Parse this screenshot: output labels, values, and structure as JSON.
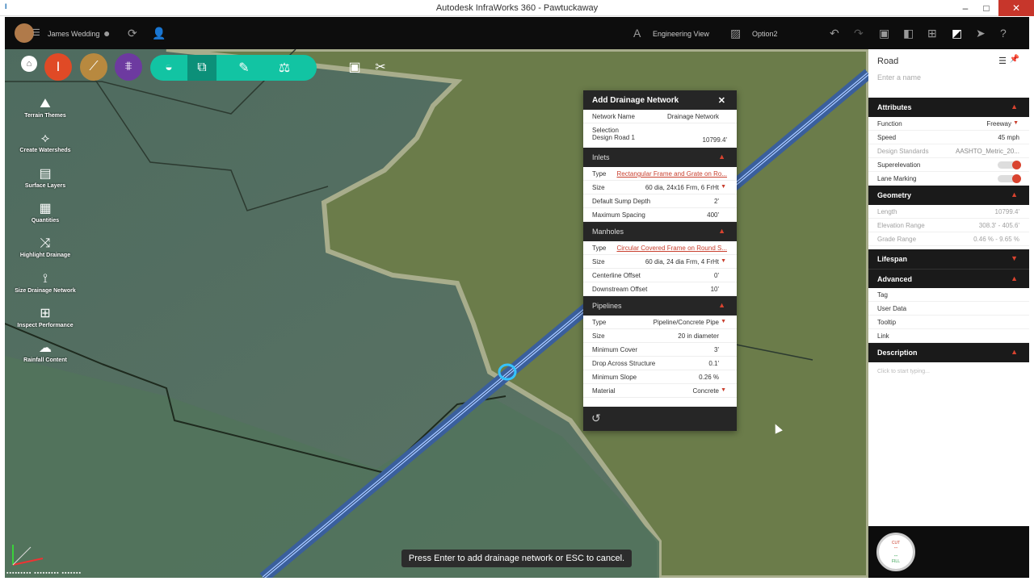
{
  "window": {
    "title": "Autodesk InfraWorks 360 - Pawtuckaway",
    "app_icon": "I"
  },
  "topbar": {
    "user": "James Wedding",
    "engineering_view": "Engineering View",
    "option": "Option2"
  },
  "left_tools": [
    {
      "label": "Terrain Themes",
      "icon": "terrain-themes-icon",
      "glyph": "⛰"
    },
    {
      "label": "Create Watersheds",
      "icon": "create-watersheds-icon",
      "glyph": "⟡"
    },
    {
      "label": "Surface Layers",
      "icon": "surface-layers-icon",
      "glyph": "▤"
    },
    {
      "label": "Quantities",
      "icon": "quantities-icon",
      "glyph": "▦"
    },
    {
      "label": "Highlight Drainage",
      "icon": "highlight-drainage-icon",
      "glyph": "⤨"
    },
    {
      "label": "Size Drainage Network",
      "icon": "size-drainage-network-icon",
      "glyph": "⟟"
    },
    {
      "label": "Inspect Performance",
      "icon": "inspect-performance-icon",
      "glyph": "⊞"
    },
    {
      "label": "Rainfall Content",
      "icon": "rainfall-content-icon",
      "glyph": "☁"
    }
  ],
  "dialog": {
    "title": "Add Drainage Network",
    "network_name_label": "Network Name",
    "network_name_value": "Drainage Network",
    "selection_label": "Selection",
    "selection_item": "Design Road 1",
    "selection_value": "10799.4'",
    "inlets": {
      "title": "Inlets",
      "rows": [
        {
          "label": "Type",
          "value": "Rectangular Frame and Grate on Ro..."
        },
        {
          "label": "Size",
          "value": "60 dia, 24x16 Frm, 6 FrHt"
        },
        {
          "label": "Default Sump Depth",
          "value": "2'"
        },
        {
          "label": "Maximum Spacing",
          "value": "400'"
        }
      ]
    },
    "manholes": {
      "title": "Manholes",
      "rows": [
        {
          "label": "Type",
          "value": "Circular Covered Frame on Round S..."
        },
        {
          "label": "Size",
          "value": "60 dia, 24 dia Frm, 4 FrHt"
        },
        {
          "label": "Centerline Offset",
          "value": "0'"
        },
        {
          "label": "Downstream Offset",
          "value": "10'"
        }
      ]
    },
    "pipelines": {
      "title": "Pipelines",
      "rows": [
        {
          "label": "Type",
          "value": "Pipeline/Concrete Pipe"
        },
        {
          "label": "Size",
          "value": "20 in diameter"
        },
        {
          "label": "Minimum Cover",
          "value": "3'"
        },
        {
          "label": "Drop Across Structure",
          "value": "0.1'"
        },
        {
          "label": "Minimum Slope",
          "value": "0.26 %"
        },
        {
          "label": "Material",
          "value": "Concrete"
        }
      ]
    }
  },
  "properties": {
    "title": "Road",
    "name_placeholder": "Enter a name",
    "attributes": {
      "title": "Attributes",
      "function_label": "Function",
      "function_value": "Freeway",
      "speed_label": "Speed",
      "speed_value": "45 mph",
      "design_standards_label": "Design Standards",
      "design_standards_value": "AASHTO_Metric_20...",
      "superelevation_label": "Superelevation",
      "lane_marking_label": "Lane Marking"
    },
    "geometry": {
      "title": "Geometry",
      "length_label": "Length",
      "length_value": "10799.4'",
      "elevation_label": "Elevation Range",
      "elevation_value": "308.3' - 405.6'",
      "grade_label": "Grade Range",
      "grade_value": "0.46 % - 9.65 %"
    },
    "lifespan": {
      "title": "Lifespan"
    },
    "advanced": {
      "title": "Advanced",
      "items": [
        "Tag",
        "User Data",
        "Tooltip",
        "Link"
      ]
    },
    "description": {
      "title": "Description",
      "placeholder": "Click to start typing..."
    }
  },
  "cutfill": {
    "cut": "CUT",
    "fill": "FILL"
  },
  "status_message": "Press Enter to add drainage network or ESC to cancel.",
  "colors": {
    "teal": "#12c4a3",
    "accent_red": "#d9432f",
    "dark": "#1a1a1a"
  }
}
